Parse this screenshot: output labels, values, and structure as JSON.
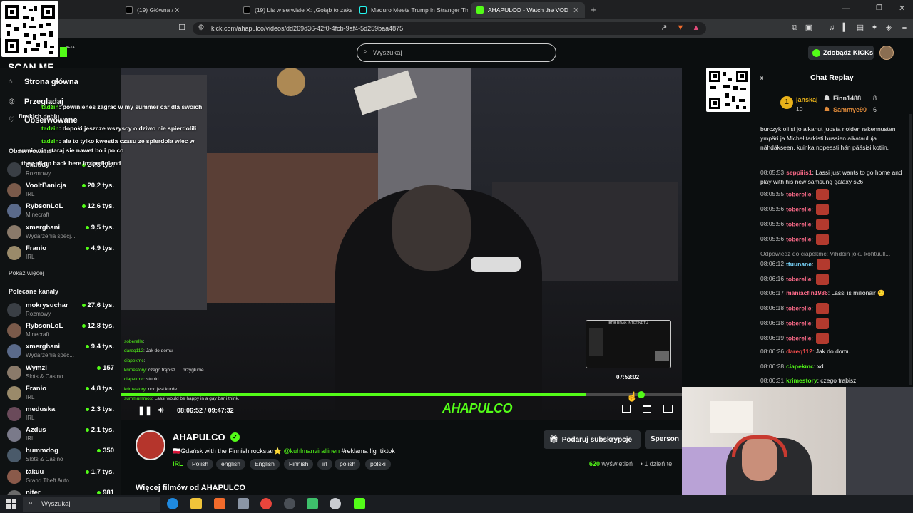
{
  "browser": {
    "tabs": [
      {
        "label": "(19) Główna / X",
        "icon": "x-logo-icon"
      },
      {
        "label": "(19) Lis w serwisie X: „Gołąb to zakała",
        "icon": "x-logo-icon"
      },
      {
        "label": "Maduro Meets Trump in Stranger Th",
        "icon": "tiktok-icon"
      },
      {
        "label": "AHAPULCO - Watch the VOD",
        "icon": "kick-icon",
        "active": true
      }
    ],
    "url": "kick.com/ahapulco/videos/dd269d36-42f0-4fcb-9af4-5d259baa4875"
  },
  "overlay": {
    "qr_caption": "SCAN ME",
    "preview_caption": "BRB BRAK INTERNETU",
    "preview_time": "07:53:02"
  },
  "header": {
    "search_placeholder": "Wyszukaj",
    "kicks_button": "Zdobądź KICKs",
    "kick_beta": "BETA"
  },
  "sidebar": {
    "nav": [
      {
        "label": "Strona główna",
        "icon": "home-icon"
      },
      {
        "label": "Przeglądaj",
        "icon": "compass-icon"
      },
      {
        "label": "Obserwowane",
        "icon": "heart-icon"
      }
    ],
    "followed_title": "Obserwowane",
    "followed": [
      {
        "name": "olkiddy",
        "category": "Rozmowy",
        "viewers": "24,8 tys."
      },
      {
        "name": "VooltBanicja",
        "category": "IRL",
        "viewers": "20,2 tys."
      },
      {
        "name": "RybsonLoL",
        "category": "Minecraft",
        "viewers": "12,6 tys."
      },
      {
        "name": "xmerghani",
        "category": "Wydarzenia specj...",
        "viewers": "9,5 tys."
      },
      {
        "name": "Franio",
        "category": "IRL",
        "viewers": "4,9 tys."
      }
    ],
    "show_more": "Pokaż więcej",
    "recommended_title": "Polecane kanały",
    "recommended": [
      {
        "name": "mokrysuchar",
        "category": "Rozmowy",
        "viewers": "27,6 tys."
      },
      {
        "name": "RybsonLoL",
        "category": "Minecraft",
        "viewers": "12,8 tys."
      },
      {
        "name": "xmerghani",
        "category": "Wydarzenia spec...",
        "viewers": "9,4 tys."
      },
      {
        "name": "Wymzi",
        "category": "Slots & Casino",
        "viewers": "157"
      },
      {
        "name": "Franio",
        "category": "IRL",
        "viewers": "4,8 tys."
      },
      {
        "name": "meduska",
        "category": "IRL",
        "viewers": "2,3 tys."
      },
      {
        "name": "Azdus",
        "category": "IRL",
        "viewers": "2,1 tys."
      },
      {
        "name": "hummdog",
        "category": "Slots & Casino",
        "viewers": "350"
      },
      {
        "name": "takuu",
        "category": "Grand Theft Auto ...",
        "viewers": "1,7 tys."
      },
      {
        "name": "niter",
        "category": "",
        "viewers": "981"
      }
    ]
  },
  "video_overlay_chat": [
    {
      "user": "tadzin",
      "text": "powinienes zagrac w my summer car dla swoich"
    },
    {
      "user": "",
      "text": "finskich debiu"
    },
    {
      "user": "tadzin",
      "text": "dopoki jeszcze wszyscy o dziwo nie spierdolili"
    },
    {
      "user": "tadzin",
      "text": "ale to tylko kwestia czasu ze spierdola wiec w"
    },
    {
      "user": "",
      "text": "sumie nie staraj sie nawet bo i po co"
    },
    {
      "user": "",
      "text": "they all go back here in the finland"
    }
  ],
  "video_small_chat": [
    {
      "user": "soberelle",
      "text": ""
    },
    {
      "user": "dareq112",
      "text": "Jak do domu"
    },
    {
      "user": "ciapekmc",
      "text": ""
    },
    {
      "user": "krimestory",
      "text": "czego trąbisz … przygłupie"
    },
    {
      "user": "ciapekmc",
      "text": "stupid"
    },
    {
      "user": "krimestory",
      "text": "noc jest kurde"
    },
    {
      "user": "summummos",
      "text": "Lassi would be happy in a gay bar i think."
    }
  ],
  "player": {
    "current_time": "08:06:52",
    "duration": "09:47:32",
    "progress": 0.828,
    "watermark": "AHAPULCO"
  },
  "channel": {
    "name": "AHAPULCO",
    "title_prefix": "🇵🇱Gdańsk with the Finnish rockstar⭐",
    "mention": "@kuhlmanvirallinen",
    "title_suffix": "#reklama !ig !tiktok",
    "tags": [
      "IRL",
      "Polish",
      "english",
      "English",
      "Finnish",
      "irl",
      "polish",
      "polski"
    ],
    "subscribe_button": "Podaruj subskrypcje",
    "sponsor_button": "Sperson",
    "views_count": "620",
    "views_label": "wyświetleń",
    "age": "1 dzień te",
    "more_videos": "Więcej filmów od AHAPULCO"
  },
  "chat": {
    "title": "Chat Replay",
    "leaderboard": [
      {
        "name": "janskaj",
        "count": "10",
        "rank": "1"
      },
      {
        "name": "Finn1488",
        "count": "8"
      },
      {
        "name": "Sammye90",
        "count": "6"
      }
    ],
    "messages": [
      {
        "time": "",
        "user": "",
        "text": "burczyk oli si jo aikanut juosta noiden rakennusten ympäri ja Michał tarkisti bussien aikatauluja nähdäkseen, kuinka nopeasti hän pääsisi kotiin.",
        "color": "#eeeeee"
      },
      {
        "time": "08:05:53",
        "user": "seppiiis1",
        "text": "Lassi just wants to go home and play with his new samsung galaxy s26",
        "color": "#ff6b8a"
      },
      {
        "time": "08:05:55",
        "user": "toberelle",
        "text": "",
        "color": "#ff6b8a"
      },
      {
        "time": "08:05:56",
        "user": "toberelle",
        "text": "",
        "color": "#ff6b8a"
      },
      {
        "time": "08:05:56",
        "user": "toberelle",
        "text": "",
        "color": "#ff6b8a"
      },
      {
        "time": "08:05:56",
        "user": "toberelle",
        "text": "",
        "color": "#ff6b8a"
      },
      {
        "time": "",
        "user": "",
        "text": "Odpowiedź do ciapekmc: Vihdoin joku kohtuull...",
        "color": "#9a9a9a"
      },
      {
        "time": "08:06:12",
        "user": "ttuunane",
        "text": "",
        "color": "#7ad7ff"
      },
      {
        "time": "08:06:16",
        "user": "toberelle",
        "text": "",
        "color": "#ff6b8a"
      },
      {
        "time": "08:06:17",
        "user": "maniacfin1986",
        "text": "Lassi is milionair 🙂",
        "color": "#ff6b8a"
      },
      {
        "time": "08:06:18",
        "user": "toberelle",
        "text": "",
        "color": "#ff6b8a"
      },
      {
        "time": "08:06:18",
        "user": "toberelle",
        "text": "",
        "color": "#ff6b8a"
      },
      {
        "time": "08:06:19",
        "user": "toberelle",
        "text": "",
        "color": "#ff6b8a"
      },
      {
        "time": "08:06:26",
        "user": "dareq112",
        "text": "Jak do domu",
        "color": "#ff4f4f"
      },
      {
        "time": "08:06:28",
        "user": "ciapekmc",
        "text": "xd",
        "color": "#53fc18"
      },
      {
        "time": "08:06:31",
        "user": "krimestory",
        "text": "czego trąbisz",
        "color": "#53fc18"
      }
    ]
  },
  "taskbar": {
    "search_placeholder": "Wyszukaj"
  },
  "colors": {
    "accent": "#53fc18",
    "background": "#0b0e0f",
    "sidebar": "#0f1213"
  }
}
